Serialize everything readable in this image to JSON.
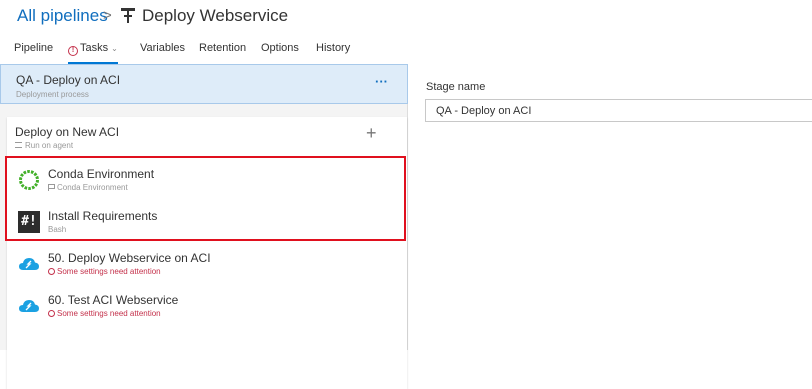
{
  "header": {
    "breadcrumb_root": "All pipelines",
    "separator": ">",
    "pipeline_title": "Deploy Webservice",
    "pipeline_icon": "pipeline-icon"
  },
  "tabs": [
    {
      "label": "Pipeline"
    },
    {
      "label": "Tasks",
      "warning": true,
      "active": true
    },
    {
      "label": "Variables"
    },
    {
      "label": "Retention"
    },
    {
      "label": "Options"
    },
    {
      "label": "History"
    }
  ],
  "stage": {
    "name": "QA - Deploy on ACI",
    "subtitle": "Deployment process",
    "more": "···"
  },
  "job": {
    "name": "Deploy on New ACI",
    "subtitle": "Run on agent",
    "add": "+"
  },
  "tasks": [
    {
      "name": "Conda Environment",
      "subtitle": "Conda Environment",
      "icon": "conda-icon",
      "status": "normal"
    },
    {
      "name": "Install Requirements",
      "subtitle": "Bash",
      "icon": "bash-icon",
      "icon_text": "#!",
      "status": "normal"
    },
    {
      "name": "50. Deploy Webservice on ACI",
      "subtitle": "Some settings need attention",
      "icon": "azure-cloud-icon",
      "status": "warning"
    },
    {
      "name": "60. Test ACI Webservice",
      "subtitle": "Some settings need attention",
      "icon": "azure-cloud-icon",
      "status": "warning"
    }
  ],
  "details": {
    "stage_name_label": "Stage name",
    "stage_name_value": "QA - Deploy on ACI"
  },
  "colors": {
    "accent": "#0078d4",
    "warning": "#c4314b",
    "highlight_box": "#e0101e",
    "stage_selected_bg": "#deecf9"
  }
}
